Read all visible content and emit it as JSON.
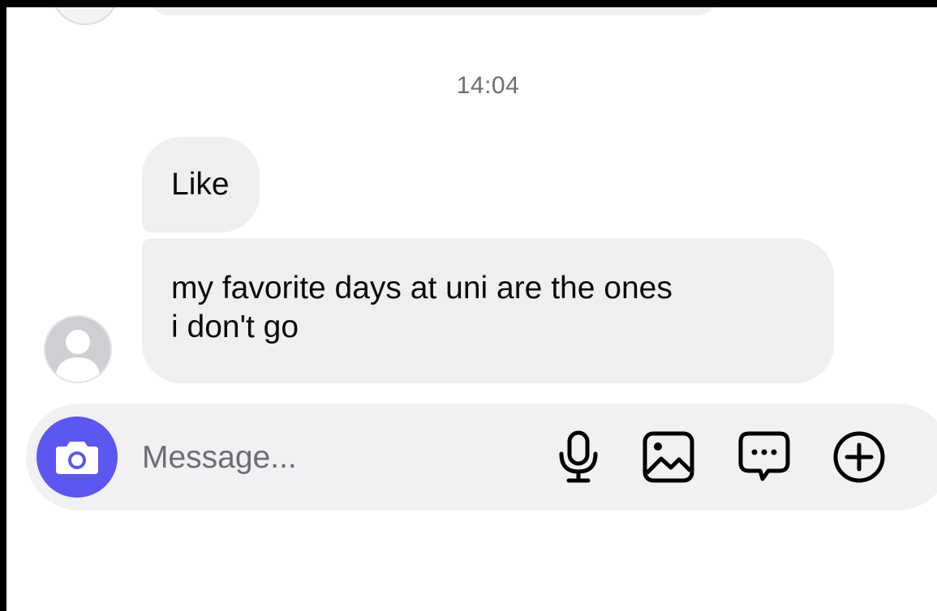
{
  "conversation": {
    "timestamp": "14:04",
    "messages": [
      {
        "sender": "other",
        "lines": [
          "Like"
        ]
      },
      {
        "sender": "other",
        "lines": [
          "my favorite days at uni are the ones",
          "i don't go"
        ]
      }
    ]
  },
  "composer": {
    "placeholder": "Message...",
    "value": "",
    "icons": {
      "camera": "camera-icon",
      "microphone": "microphone-icon",
      "gallery": "gallery-icon",
      "sticker": "sticker-icon",
      "plus": "plus-icon"
    }
  },
  "colors": {
    "accent": "#5b57f0",
    "bubble": "#efeff1",
    "composer_bg": "#f1f1f3",
    "timestamp": "#6e6e73",
    "placeholder": "#6d6d72"
  }
}
